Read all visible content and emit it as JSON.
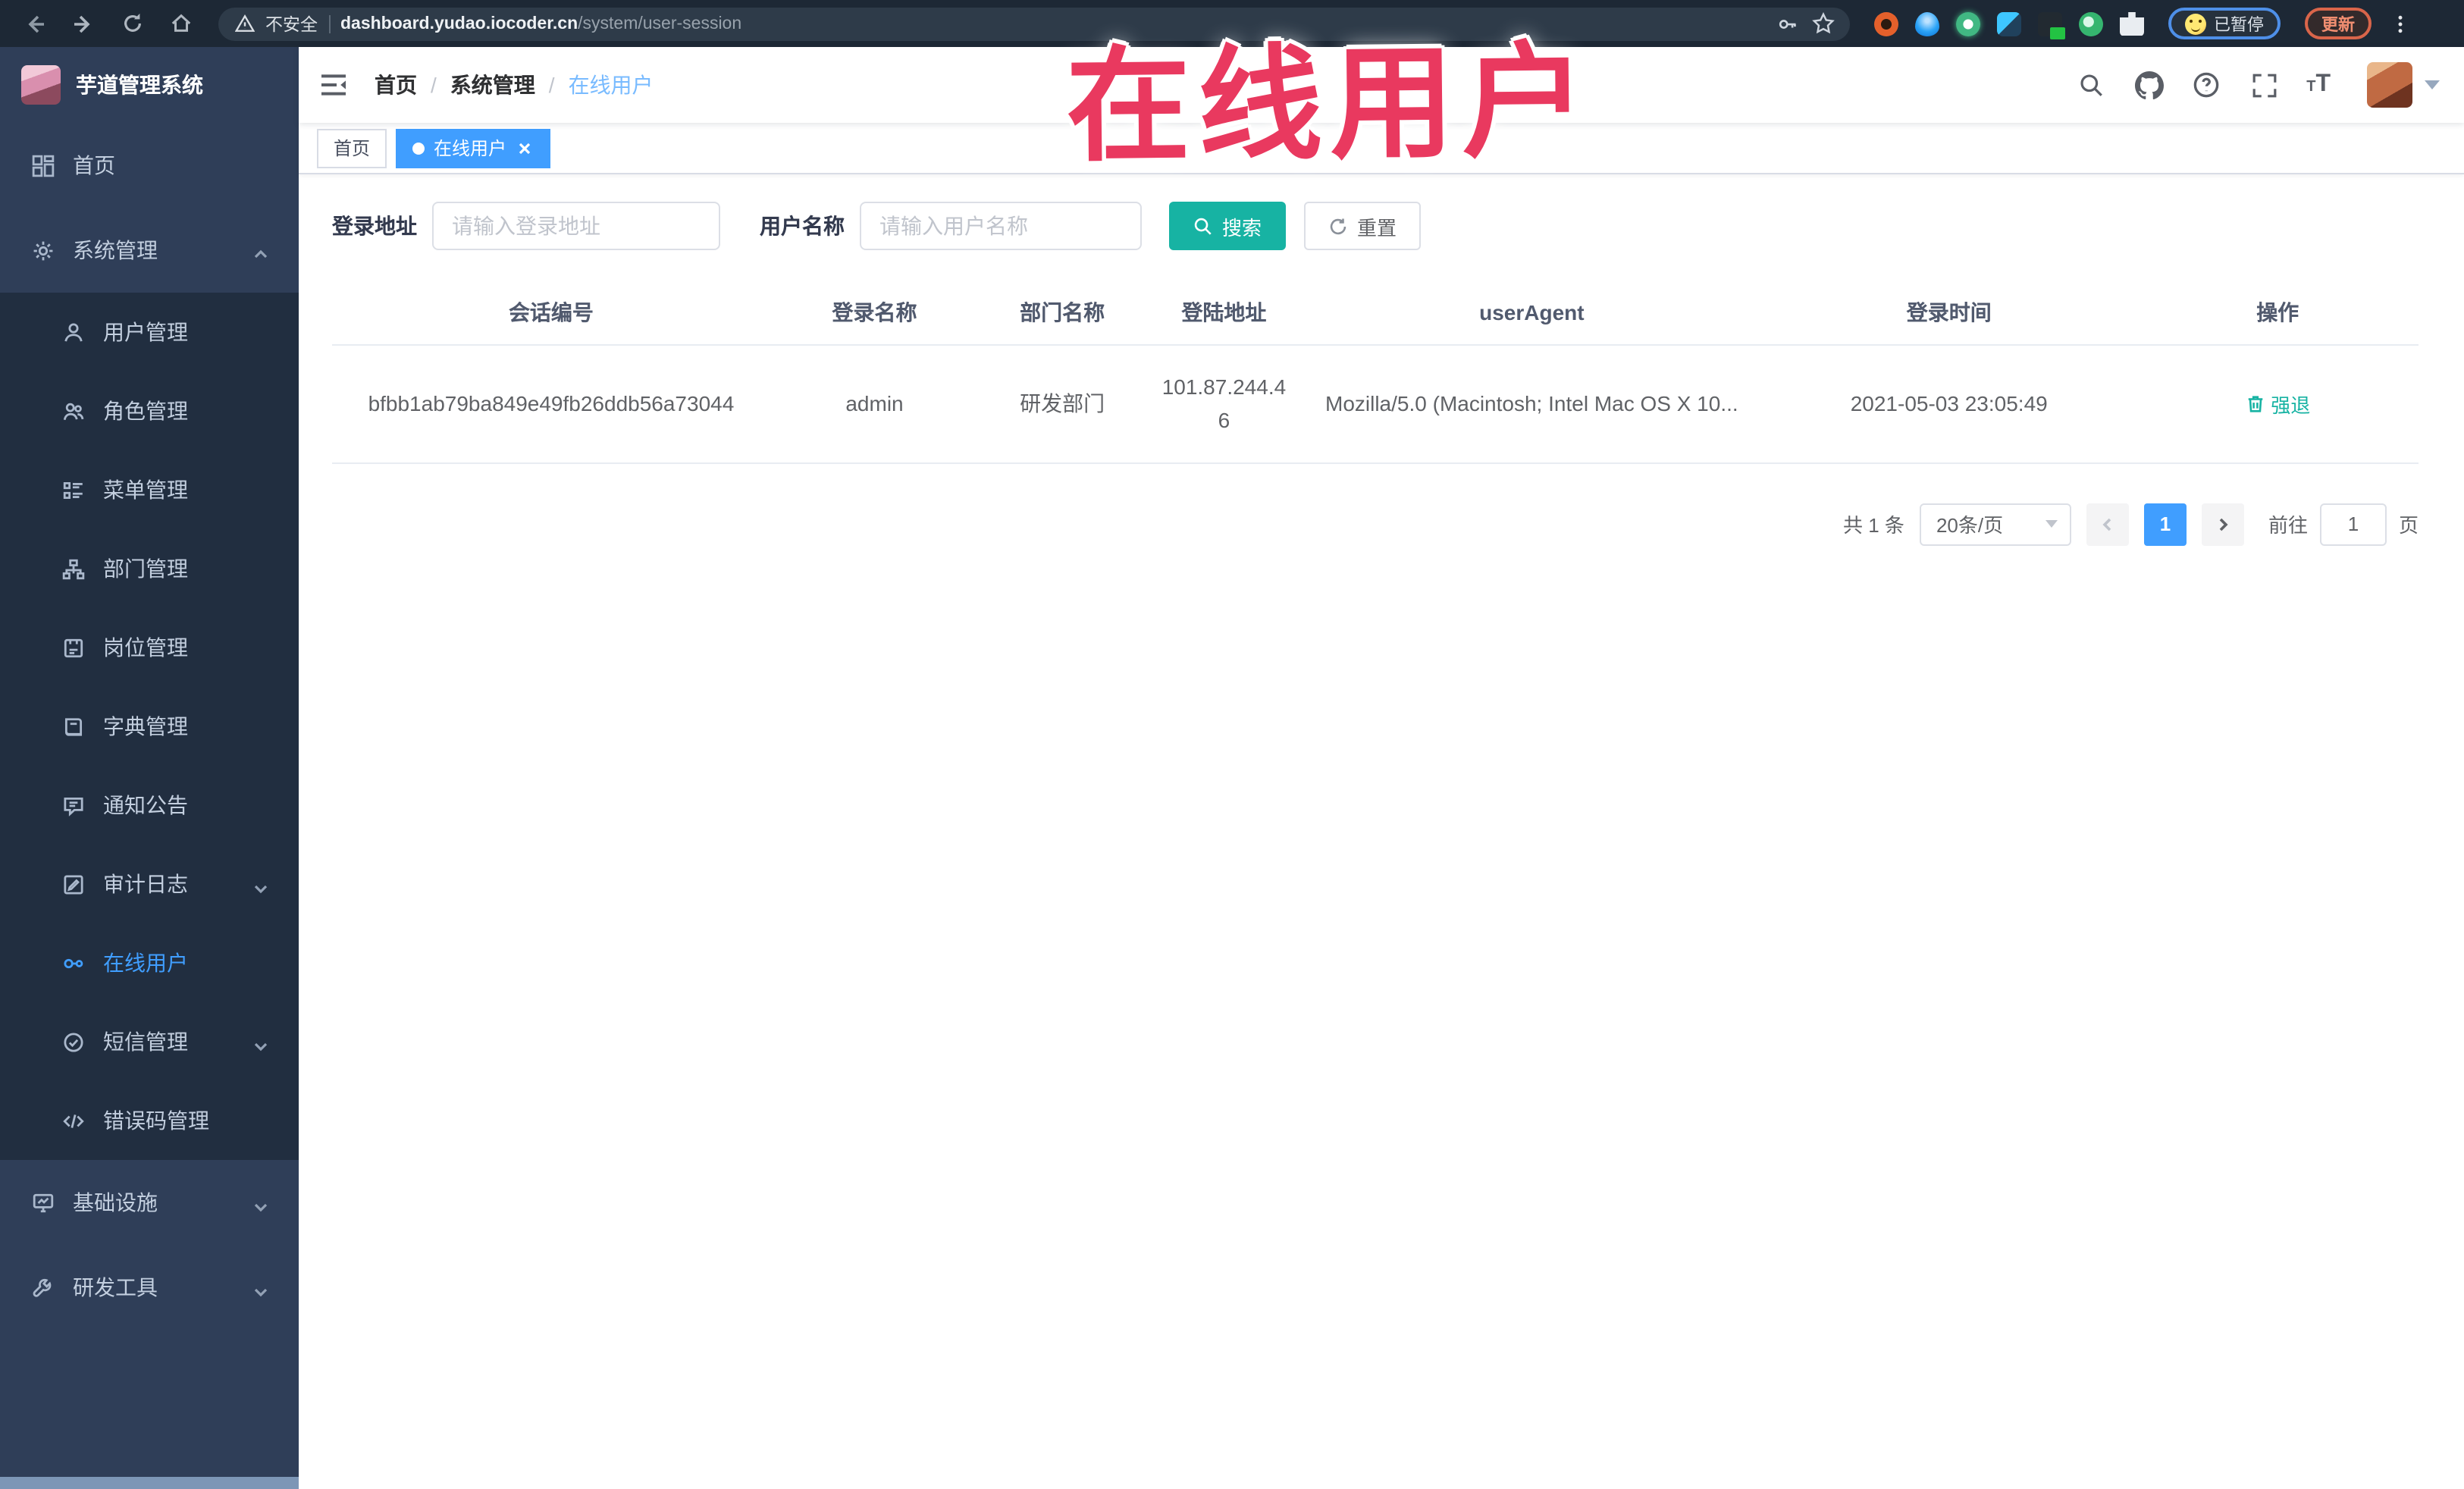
{
  "browser": {
    "security_label": "不安全",
    "url_domain": "dashboard.yudao.iocoder.cn",
    "url_path": "/system/user-session",
    "paused_badge": "已暂停",
    "update_label": "更新",
    "icons": [
      "back-icon",
      "forward-icon",
      "reload-icon",
      "home-icon",
      "warning-icon",
      "key-icon",
      "bookmark-star-icon",
      "extension-icons",
      "profile-paused-chip",
      "update-chip",
      "kebab-menu-icon"
    ]
  },
  "overlay": {
    "text": "在线用户",
    "color": "#e9395f"
  },
  "sidebar": {
    "logo_title": "芋道管理系统",
    "items": [
      {
        "label": "首页",
        "icon": "dashboard-icon"
      },
      {
        "label": "系统管理",
        "icon": "gear-icon",
        "expanded": true
      },
      {
        "label": "用户管理",
        "icon": "user-icon"
      },
      {
        "label": "角色管理",
        "icon": "roles-icon"
      },
      {
        "label": "菜单管理",
        "icon": "menu-list-icon"
      },
      {
        "label": "部门管理",
        "icon": "org-tree-icon"
      },
      {
        "label": "岗位管理",
        "icon": "badge-icon"
      },
      {
        "label": "字典管理",
        "icon": "dict-book-icon"
      },
      {
        "label": "通知公告",
        "icon": "announcement-icon"
      },
      {
        "label": "审计日志",
        "icon": "audit-log-icon",
        "collapsible": true
      },
      {
        "label": "在线用户",
        "icon": "online-users-icon",
        "active": true
      },
      {
        "label": "短信管理",
        "icon": "sms-icon",
        "collapsible": true
      },
      {
        "label": "错误码管理",
        "icon": "code-icon"
      },
      {
        "label": "基础设施",
        "icon": "infrastructure-icon",
        "collapsible": true
      },
      {
        "label": "研发工具",
        "icon": "devtools-icon",
        "collapsible": true
      }
    ]
  },
  "breadcrumb": {
    "items": [
      "首页",
      "系统管理",
      "在线用户"
    ]
  },
  "tags": {
    "home_label": "首页",
    "active_label": "在线用户"
  },
  "filters": {
    "address_label": "登录地址",
    "address_placeholder": "请输入登录地址",
    "username_label": "用户名称",
    "username_placeholder": "请输入用户名称",
    "search_label": "搜索",
    "reset_label": "重置"
  },
  "table": {
    "headers": [
      "会话编号",
      "登录名称",
      "部门名称",
      "登陆地址",
      "userAgent",
      "登录时间",
      "操作"
    ],
    "rows": [
      {
        "session_id": "bfbb1ab79ba849e49fb26ddb56a73044",
        "login_name": "admin",
        "dept_name": "研发部门",
        "login_address": "101.87.244.46",
        "user_agent": "Mozilla/5.0 (Macintosh; Intel Mac OS X 10...",
        "login_time": "2021-05-03 23:05:49",
        "action_label": "强退"
      }
    ]
  },
  "pagination": {
    "total_text": "共 1 条",
    "page_size": "20条/页",
    "current_page": "1",
    "goto_label": "前往",
    "goto_value": "1",
    "page_unit": "页"
  },
  "colors": {
    "accent_teal": "#17b3a3",
    "accent_blue": "#409eff",
    "sidebar_bg": "#2f3e58",
    "submenu_bg": "#212e40",
    "tag_active": "#409eff"
  }
}
